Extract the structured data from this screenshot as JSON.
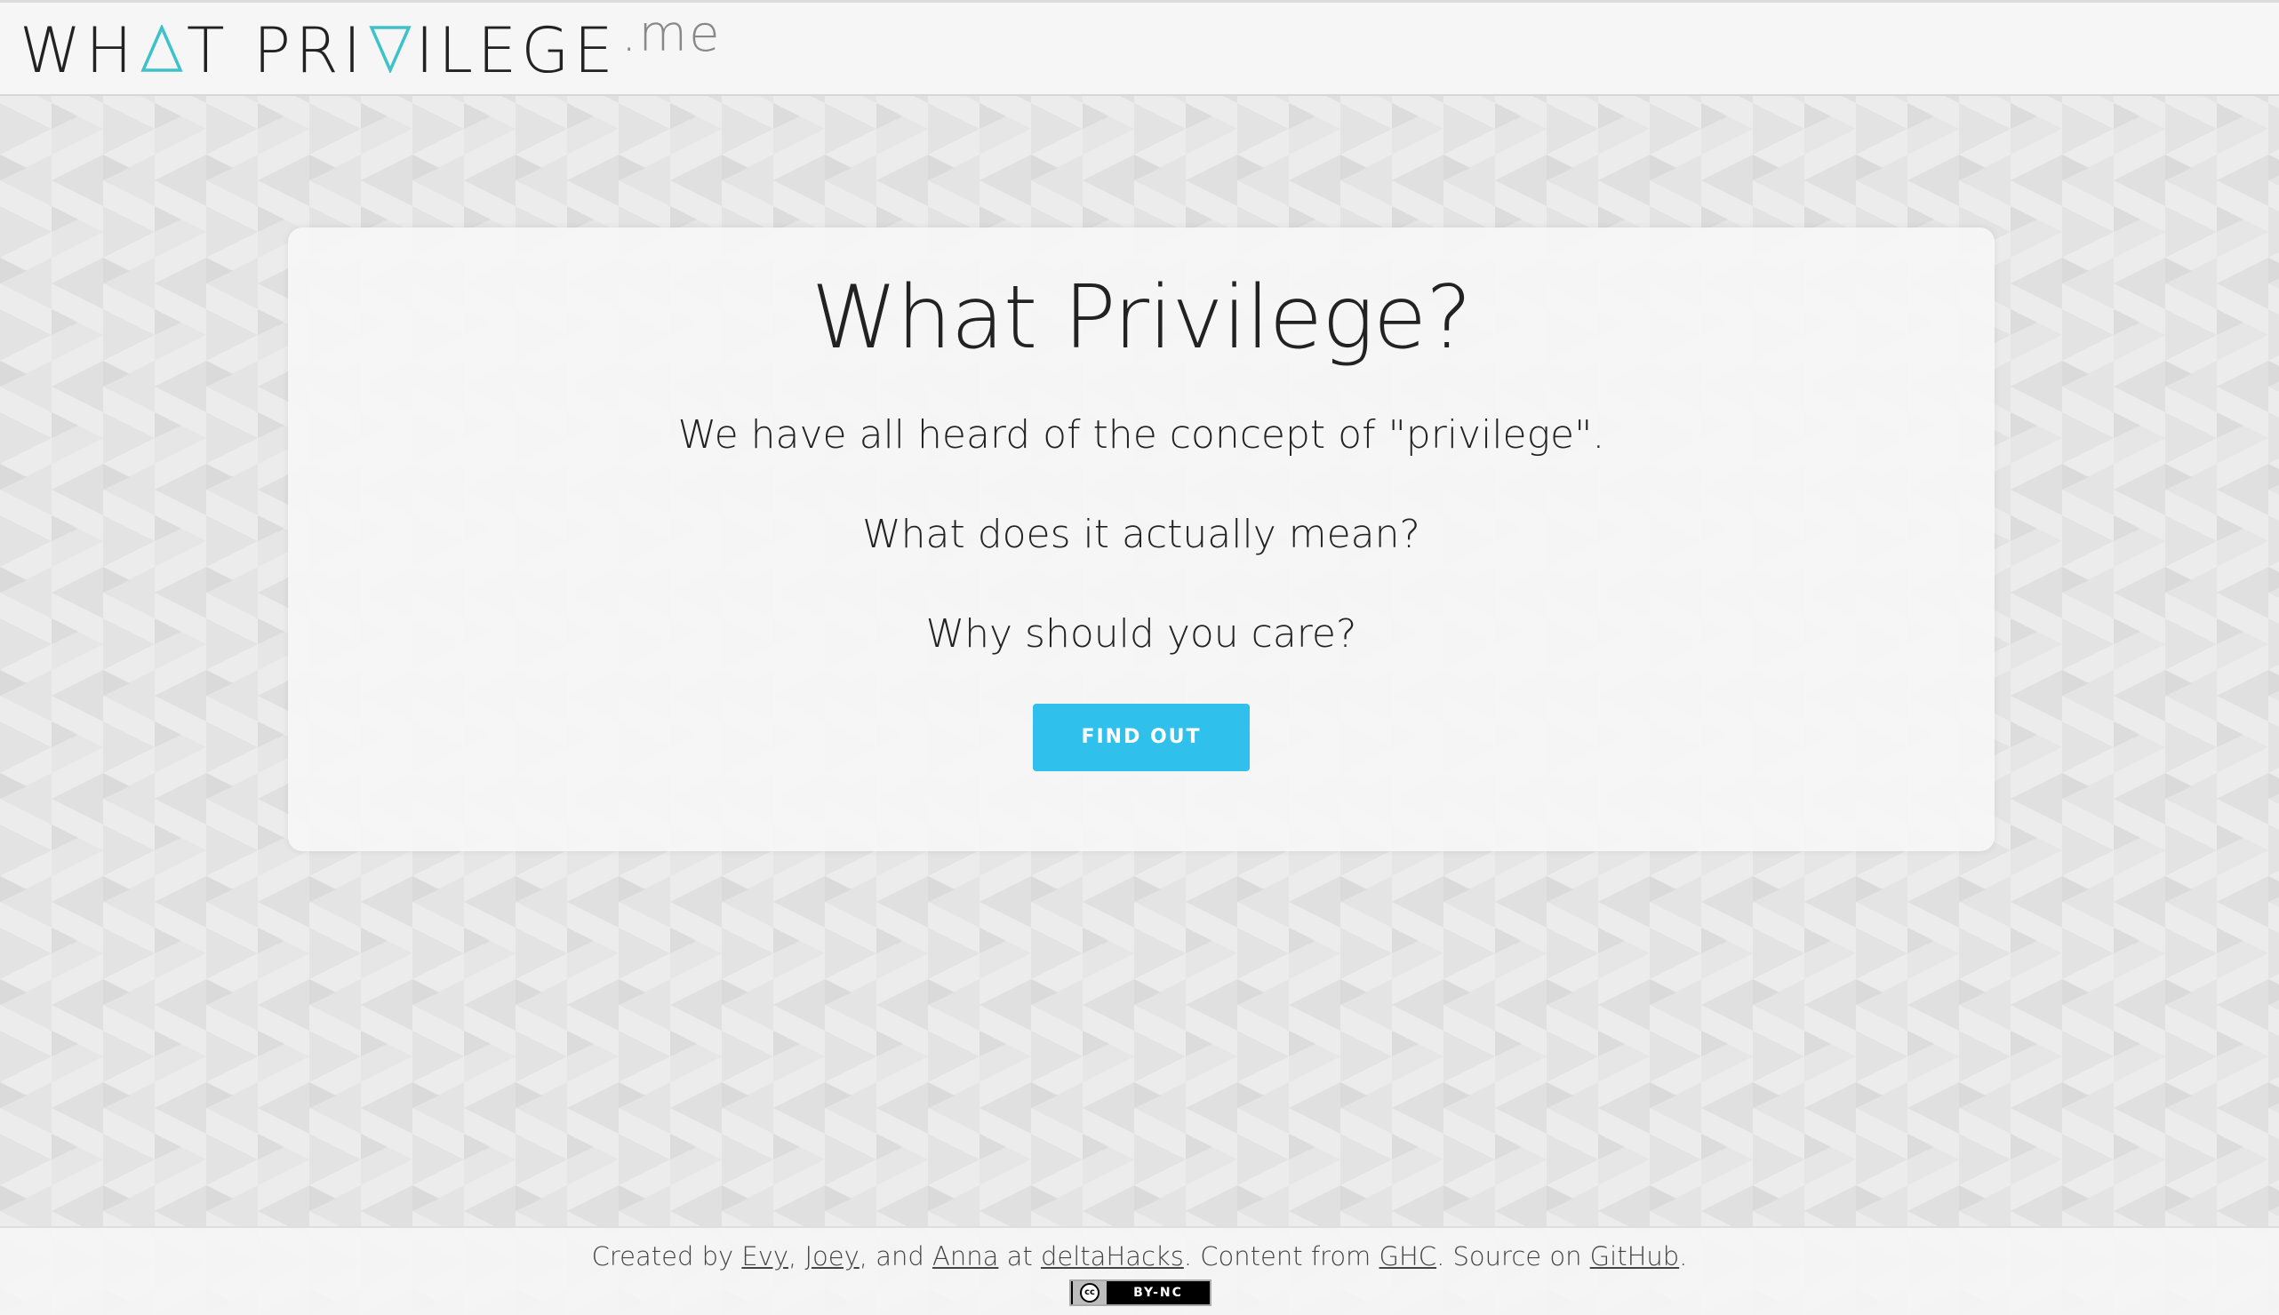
{
  "header": {
    "logo_part1": "WH",
    "logo_part2": "T PRI",
    "logo_part3": "ILEGE",
    "logo_tld": ".me",
    "logo_accent_color": "#3cc3c9"
  },
  "hero": {
    "title": "What Privilege?",
    "line1": "We have all heard of the concept of \"privilege\".",
    "line2": "What does it actually mean?",
    "line3": "Why should you care?",
    "button_label": "FIND OUT",
    "button_color": "#2fc0ec"
  },
  "footer": {
    "created_by": "Created by ",
    "author1": "Evy",
    "sep1": ", ",
    "author2": "Joey",
    "sep2": ", and ",
    "author3": "Anna",
    "at": " at ",
    "event": "deltaHacks",
    "content_from": ". Content from ",
    "content_source": "GHC",
    "source_on": ". Source on ",
    "repo_host": "GitHub",
    "end": ".",
    "license_badge": "BY-NC",
    "license_cc": "cc"
  }
}
